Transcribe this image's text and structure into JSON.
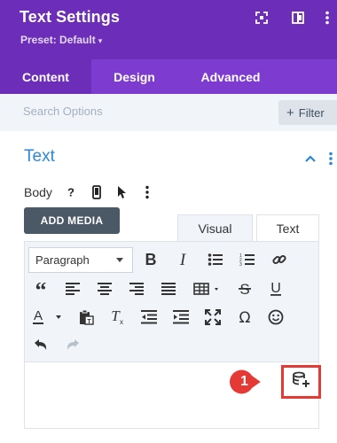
{
  "header": {
    "title": "Text Settings",
    "preset_label": "Preset: Default",
    "colors": {
      "bg": "#6c2eb9",
      "tabs_bg": "#7e3bd0",
      "accent": "#2b87da"
    }
  },
  "header_icons": [
    "expand-icon",
    "sidebar-layout-icon",
    "kebab-icon"
  ],
  "tabs": [
    {
      "label": "Content",
      "active": true
    },
    {
      "label": "Design",
      "active": false
    },
    {
      "label": "Advanced",
      "active": false
    }
  ],
  "search": {
    "placeholder": "Search Options",
    "filter_label": "Filter"
  },
  "section": {
    "title": "Text",
    "body_label": "Body",
    "add_media_label": "ADD MEDIA",
    "editor_tabs": [
      {
        "label": "Visual",
        "active": true
      },
      {
        "label": "Text",
        "active": false
      }
    ],
    "format_select": "Paragraph"
  },
  "toolbar_icons": [
    "bold-icon",
    "italic-icon",
    "bulleted-list-icon",
    "numbered-list-icon",
    "link-icon",
    "blockquote-icon",
    "align-left-icon",
    "align-center-icon",
    "align-right-icon",
    "justify-icon",
    "table-icon",
    "strikethrough-icon",
    "underline-icon",
    "text-color-icon",
    "paste-text-icon",
    "clear-format-icon",
    "outdent-icon",
    "indent-icon",
    "fullscreen-icon",
    "omega-icon",
    "emoji-icon",
    "undo-icon",
    "redo-icon"
  ],
  "callout": {
    "number": "1",
    "color": "#e53935",
    "target": "dynamic-content-icon"
  }
}
